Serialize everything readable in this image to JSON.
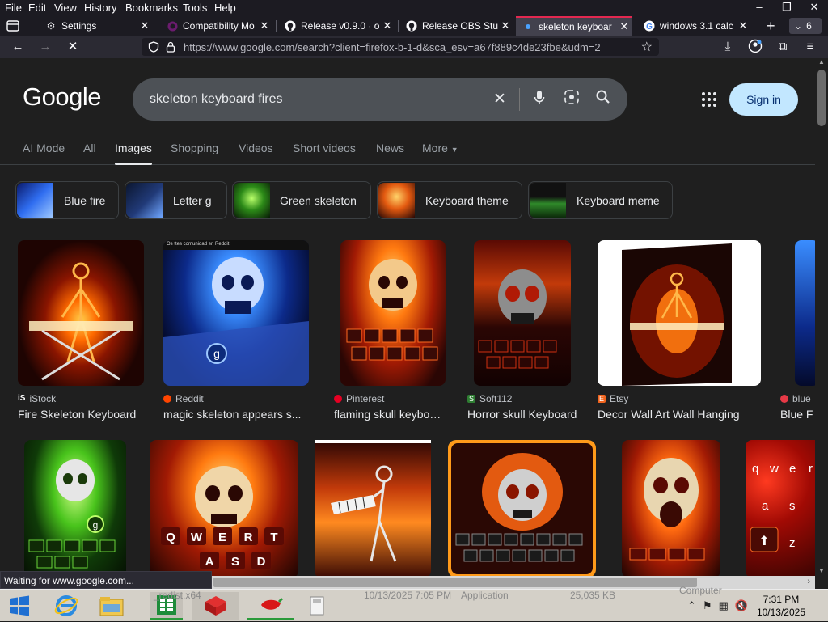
{
  "menu": {
    "items": [
      "File",
      "Edit",
      "View",
      "History",
      "Bookmarks",
      "Tools",
      "Help"
    ]
  },
  "window_controls": {
    "minimize": "–",
    "restore": "❐",
    "close": "✕"
  },
  "tabs": [
    {
      "title": "Settings",
      "icon": "gear-icon"
    },
    {
      "title": "Compatibility Mo",
      "icon": "circle-icon"
    },
    {
      "title": "Release v0.9.0 · ol",
      "icon": "github-icon"
    },
    {
      "title": "Release OBS Stud",
      "icon": "github-icon"
    },
    {
      "title": "skeleton keyboar",
      "icon": "dot-icon"
    },
    {
      "title": "windows 3.1 calc",
      "icon": "google-icon"
    }
  ],
  "tab_count": "6",
  "url": "https://www.google.com/search?client=firefox-b-1-d&sca_esv=a67f889c4de23fbe&udm=2",
  "google": {
    "logo": "Google",
    "query": "skeleton keyboard fires",
    "sign_in": "Sign in",
    "nav_tabs": [
      "AI Mode",
      "All",
      "Images",
      "Shopping",
      "Videos",
      "Short videos",
      "News",
      "More"
    ],
    "chips": [
      "Blue fire",
      "Letter g",
      "Green skeleton",
      "Keyboard theme",
      "Keyboard meme"
    ]
  },
  "results_row1": [
    {
      "source": "iStock",
      "title": "Fire Skeleton Keyboard"
    },
    {
      "source": "Reddit",
      "title": "magic skeleton appears s..."
    },
    {
      "source": "Pinterest",
      "title": "flaming skull keyboard"
    },
    {
      "source": "Soft112",
      "title": "Horror skull Keyboard"
    },
    {
      "source": "Etsy",
      "title": "Decor Wall Art Wall Hanging"
    },
    {
      "source": "blue",
      "title": "Blue F"
    }
  ],
  "reddit_overlay": "Os ttes comunidad en Reddit",
  "colors": {
    "accent": "#e22850",
    "sign_in_bg": "#c2e7ff"
  },
  "status": "Waiting for www.google.com...",
  "taskbar": {
    "behind_text": {
      "date": "10/13/2025 7:05 PM",
      "type": "Application",
      "size": "25,035 KB",
      "label": "Computer",
      "red": "_redist.x64"
    },
    "time": "7:31 PM",
    "date": "10/13/2025"
  }
}
